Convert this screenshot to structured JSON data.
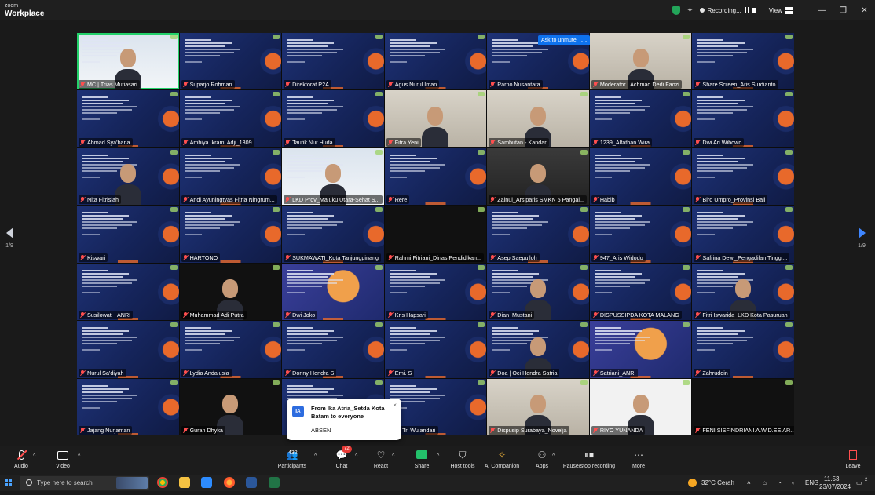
{
  "app": {
    "brand_top": "zoom",
    "brand_bottom": "Workplace",
    "recording_label": "Recording...",
    "view_label": "View",
    "window_controls": [
      "minimize-icon",
      "restore-icon",
      "close-icon"
    ]
  },
  "meeting": {
    "ask_to_unmute": "Ask to unmute",
    "ask_more": "…",
    "page_left": "1/9",
    "page_right": "1/9",
    "participants": [
      "MC | Trias Mutiasari",
      "Suparjo Rohman",
      "Direktorat P2A",
      "Agus Nurul Iman",
      "Parno Nusantara",
      "Moderator | Achmad Dedi Faozi",
      "Share Screen_Aris Surdianto",
      "Ahmad Sya'bana",
      "Ambiya Ikrami Adji_1309",
      "Taufik Nur Huda",
      "Fitra Yeni",
      "Sambutan - Kandar",
      "1239_Alfathan Wira",
      "Dwi Ari Wibowo",
      "Nita Fitrisiah",
      "Andi Ayuningtyas Fitria Ningrum...",
      "LKD Prov_Maluku Utara-Sehat S...",
      "Rere",
      "Zainul_Arsiparis SMKN 5 Pangal...",
      "Habib",
      "Biro Umpro_Provinsi Bali",
      "Kiswari",
      "HARTONO",
      "SUKMAWATI_Kota Tanjungpinang",
      "Rahmi Fitriani_Dinas Pendidikan...",
      "Asep Saepulloh",
      "947_Aris Widodo",
      "Safrina Dewi_Pengadilan Tinggi...",
      "Susilowati_ ANRI",
      "Muhammad Adi Putra",
      "Dwi Joko",
      "Kris Hapsari",
      "Dian_Mustani",
      "DISPUSSIPDA KOTA MALANG",
      "Fitri Iswarida_LKD Kota Pasuruan",
      "Nurul Sa'diyah",
      "Lydia Andalusia",
      "Donny Hendra S",
      "Erni. S",
      "Doa | Oci Hendra Satria",
      "Satriani_ANRI",
      "Zahruddin",
      "Jajang Nurjaman",
      "Guran Dhyka",
      "",
      "...i Tri Wulandari",
      "Dispusip Surabaya_Novelja",
      "RIYO YUNANDA",
      "FENI SISFINDRIANI.A.W.D.EE.AR..."
    ]
  },
  "chat_popup": {
    "avatar": "IA",
    "from": "From Ika Atria_Setda Kota Batam to everyone",
    "message": "ABSEN",
    "close": "×"
  },
  "toolbar": {
    "audio": "Audio",
    "video": "Video",
    "participants": "Participants",
    "participants_count": "432",
    "chat": "Chat",
    "chat_badge": "72",
    "react": "React",
    "share": "Share",
    "host_tools": "Host tools",
    "ai_companion": "AI Companion",
    "apps": "Apps",
    "pause_stop": "Pause/stop recording",
    "more": "More",
    "leave": "Leave"
  },
  "taskbar": {
    "search_placeholder": "Type here to search",
    "weather": "32°C  Cerah",
    "language": "ENG",
    "time": "11.53",
    "date": "23/07/2024",
    "notif_count": "2"
  },
  "colors": {
    "active_speaker": "#23d16a",
    "muted_red": "#ff4f4f",
    "zoom_blue": "#0e72ed",
    "share_green": "#23c16b"
  }
}
